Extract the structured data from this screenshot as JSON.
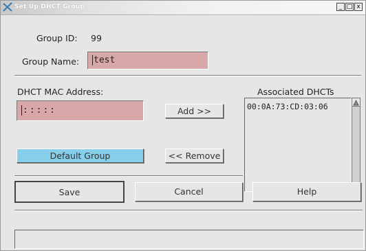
{
  "window": {
    "title": "Set Up DHCT Group",
    "buttons": {
      "minimize": "_",
      "maximize": "□",
      "close": "x"
    }
  },
  "group": {
    "id_label": "Group ID:",
    "id_value": "99",
    "name_label": "Group Name:",
    "name_value": "test"
  },
  "mac": {
    "label": "DHCT MAC Address:",
    "value": ":::::"
  },
  "buttons": {
    "add": "Add >>",
    "remove": "<< Remove",
    "default_group": "Default Group",
    "save": "Save",
    "cancel": "Cancel",
    "help": "Help"
  },
  "associated": {
    "label": "Associated DHCTs",
    "items": [
      "00:0A:73:CD:03:06"
    ]
  },
  "colors": {
    "field_bg": "#d8a8a8",
    "default_group_bg": "#87ceeb"
  }
}
